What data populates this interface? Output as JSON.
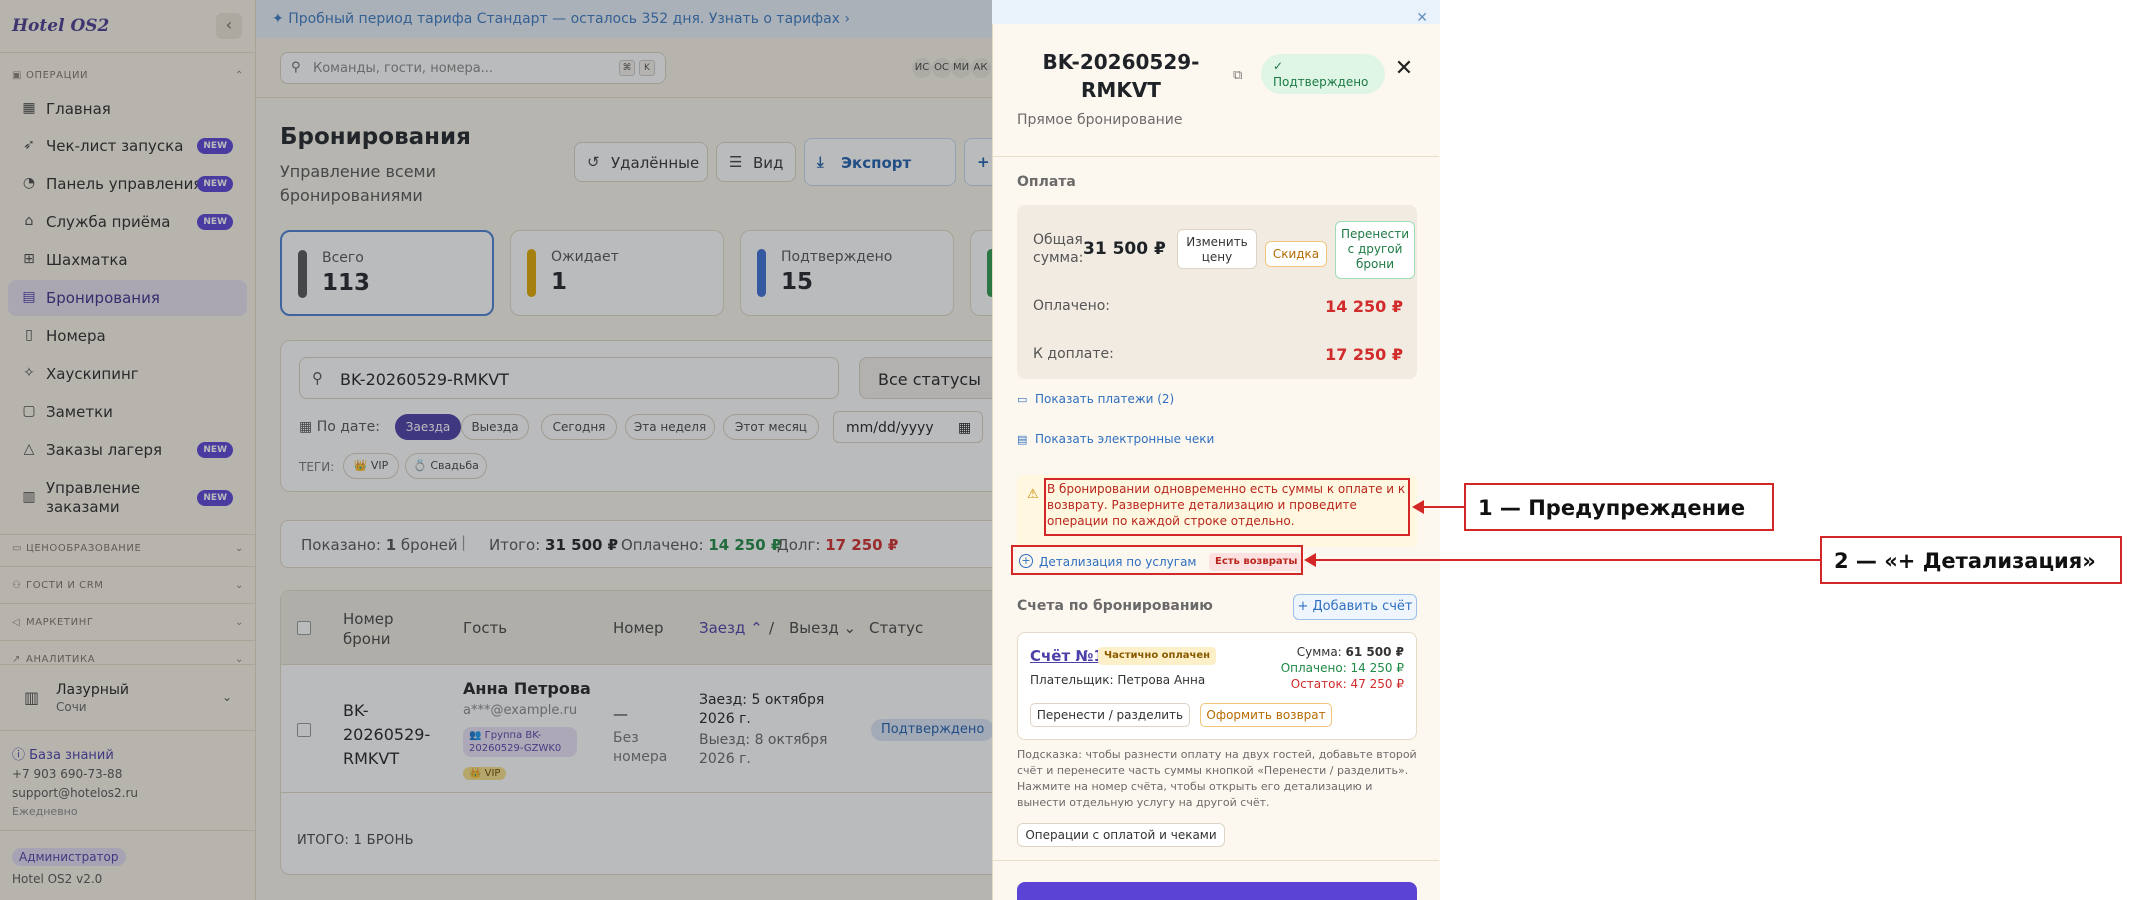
{
  "sidebar": {
    "logo": "Hotel OS2",
    "section_operations": "ОПЕРАЦИИ",
    "items": [
      {
        "label": "Главная",
        "icon": "grid-icon",
        "new": false
      },
      {
        "label": "Чек-лист запуска",
        "icon": "rocket-icon",
        "new": true
      },
      {
        "label": "Панель управления",
        "icon": "gauge-icon",
        "new": true
      },
      {
        "label": "Служба приёма",
        "icon": "bell-icon",
        "new": true
      },
      {
        "label": "Шахматка",
        "icon": "chess-grid-icon",
        "new": false
      },
      {
        "label": "Бронирования",
        "icon": "calendar-icon",
        "new": false,
        "active": true
      },
      {
        "label": "Номера",
        "icon": "door-icon",
        "new": false
      },
      {
        "label": "Хаускипинг",
        "icon": "broom-icon",
        "new": false
      },
      {
        "label": "Заметки",
        "icon": "note-icon",
        "new": false
      },
      {
        "label": "Заказы лагеря",
        "icon": "tent-icon",
        "new": true
      },
      {
        "label": "Управление заказами",
        "icon": "orders-icon",
        "new": true
      }
    ],
    "new_badge": "NEW",
    "sections": [
      "ЦЕНООБРАЗОВАНИЕ",
      "ГОСТИ И CRM",
      "МАРКЕТИНГ",
      "АНАЛИТИКА"
    ],
    "hotel_name": "Лазурный",
    "hotel_city": "Сочи",
    "knowledge_base": "База знаний",
    "phone": "+7 903 690-73-88",
    "email": "support@hotelos2.ru",
    "schedule": "Ежедневно",
    "role": "Администратор",
    "version": "Hotel OS2 v2.0"
  },
  "trial": {
    "text": "Пробный период тарифа Стандарт — осталось 352 дня.",
    "link": "Узнать о тарифах ›"
  },
  "topbar": {
    "search_placeholder": "Команды, гости, номера...",
    "kbd1": "⌘",
    "kbd2": "K",
    "avatars": [
      "ИС",
      "ОС",
      "МИ",
      "АК"
    ]
  },
  "page": {
    "title": "Бронирования",
    "subtitle": "Управление всеми бронированиями",
    "btn_deleted": "Удалённые",
    "btn_view": "Вид",
    "btn_export": "Экспорт"
  },
  "stats": [
    {
      "label": "Всего",
      "value": "113",
      "color": "#555555"
    },
    {
      "label": "Ожидает",
      "value": "1",
      "color": "#e0a800"
    },
    {
      "label": "Подтверждено",
      "value": "15",
      "color": "#3a6fd8"
    }
  ],
  "filters": {
    "search_value": "BK-20260529-RMKVT",
    "status": "Все статусы",
    "date_label": "По дате:",
    "chips": [
      "Заезда",
      "Выезда",
      "Сегодня",
      "Эта неделя",
      "Этот месяц"
    ],
    "date_placeholder": "mm/dd/yyyy",
    "tags_label": "ТЕГИ:",
    "tags": [
      "👑 VIP",
      "💍 Свадьба"
    ]
  },
  "summary": {
    "shown_prefix": "Показано:",
    "shown_count": "1",
    "shown_suffix": "броней",
    "total_label": "Итого:",
    "total": "31 500 ₽",
    "paid_label": "Оплачено:",
    "paid": "14 250 ₽",
    "debt_label": "Долг:",
    "debt": "17 250 ₽"
  },
  "table": {
    "headers": [
      "Номер брони",
      "Гость",
      "Номер",
      "Заезд",
      "/",
      "Выезд",
      "Статус"
    ],
    "row": {
      "booking": "BK-20260529-RMKVT",
      "guest": "Анна Петрова",
      "guest_email": "a***@example.ru",
      "group": "👥 Группа BK-20260529-GZWK0",
      "vip": "👑 VIP",
      "room": "—",
      "room_note": "Без номера",
      "checkin": "Заезд: 5 октября 2026 г.",
      "checkout": "Выезд: 8 октября 2026 г.",
      "status": "Подтверждено"
    },
    "footer": "ИТОГО: 1 БРОНЬ"
  },
  "drawer": {
    "title": "BK-20260529-RMKVT",
    "status_icon": "check-circle-icon",
    "status": "Подтверждено",
    "subtitle": "Прямое бронирование",
    "payment_title": "Оплата",
    "total_label": "Общая сумма:",
    "total_value": "31 500 ₽",
    "change_price": "Изменить цену",
    "discount": "Скидка",
    "transfer": "Перенести с другой брони",
    "paid_label": "Оплачено:",
    "paid_value": "14 250 ₽",
    "due_label": "К доплате:",
    "due_value": "17 250 ₽",
    "show_payments": "Показать платежи (2)",
    "show_receipts": "Показать электронные чеки",
    "warning": "В бронировании одновременно есть суммы к оплате и к возврату. Разверните детализацию и проведите операции по каждой строке отдельно.",
    "details": "Детализация по услугам",
    "refund_badge": "Есть возвраты",
    "invoices_title": "Счета по бронированию",
    "add_invoice": "+ Добавить счёт",
    "invoice": {
      "number": "Счёт №1",
      "badge": "Частично оплачен",
      "payer": "Плательщик: Петрова Анна",
      "sum_label": "Сумма:",
      "sum": "61 500 ₽",
      "paid": "Оплачено: 14 250 ₽",
      "rest": "Остаток: 47 250 ₽",
      "btn_transfer": "Перенести / разделить",
      "btn_refund": "Оформить возврат"
    },
    "hint": "Подсказка: чтобы разнести оплату на двух гостей, добавьте второй счёт и перенесите часть суммы кнопкой «Перенести / разделить». Нажмите на номер счёта, чтобы открыть его детализацию и вынести отдельную услугу на другой счёт.",
    "ops_button": "Операции с оплатой и чеками"
  },
  "annotations": {
    "one": "1 — Предупреждение",
    "two": "2 — «+ Детализация»",
    "color": "#d42727"
  }
}
